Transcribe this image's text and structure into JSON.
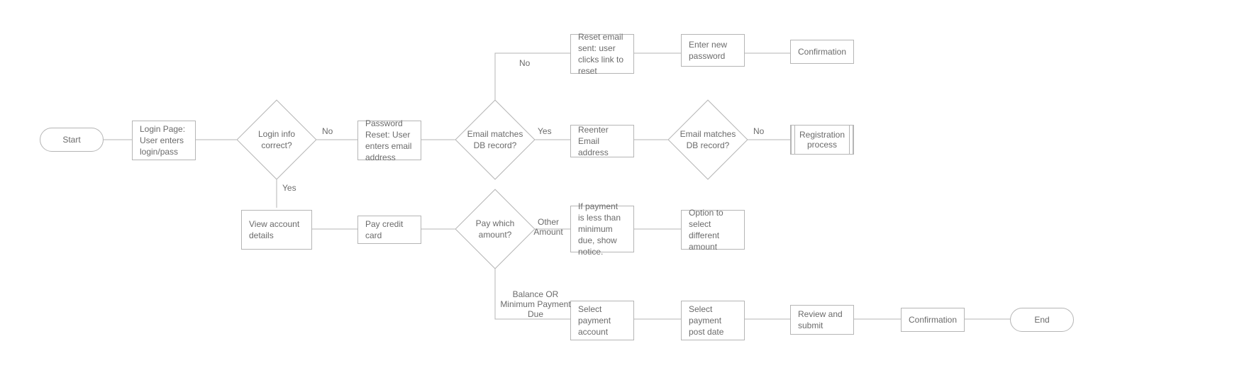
{
  "nodes": {
    "start": "Start",
    "login": "Login Page: User enters login/pass",
    "login_ok": "Login info correct?",
    "pw_reset": "Password Reset: User enters email address",
    "email_match1": "Email matches DB record?",
    "reset_email": "Reset email sent: user clicks link to reset",
    "enter_new_pw": "Enter new password",
    "conf1": "Confirmation",
    "reenter_email": "Reenter Email address",
    "email_match2": "Email matches DB record?",
    "registration": "Registration process",
    "view_acct": "View account details",
    "pay_card": "Pay credit card",
    "pay_which": "Pay which amount?",
    "if_less": "If payment is less than minimum due, show notice.",
    "opt_diff": "Option to select different amount",
    "sel_acct": "Select payment account",
    "sel_date": "Select payment post date",
    "review": "Review and submit",
    "conf2": "Confirmation",
    "end": "End"
  },
  "edge_labels": {
    "no1": "No",
    "yes1": "Yes",
    "no2": "No",
    "yes2": "Yes",
    "no3": "No",
    "other": "Other Amount",
    "balance": "Balance OR Minimum Payment Due"
  }
}
